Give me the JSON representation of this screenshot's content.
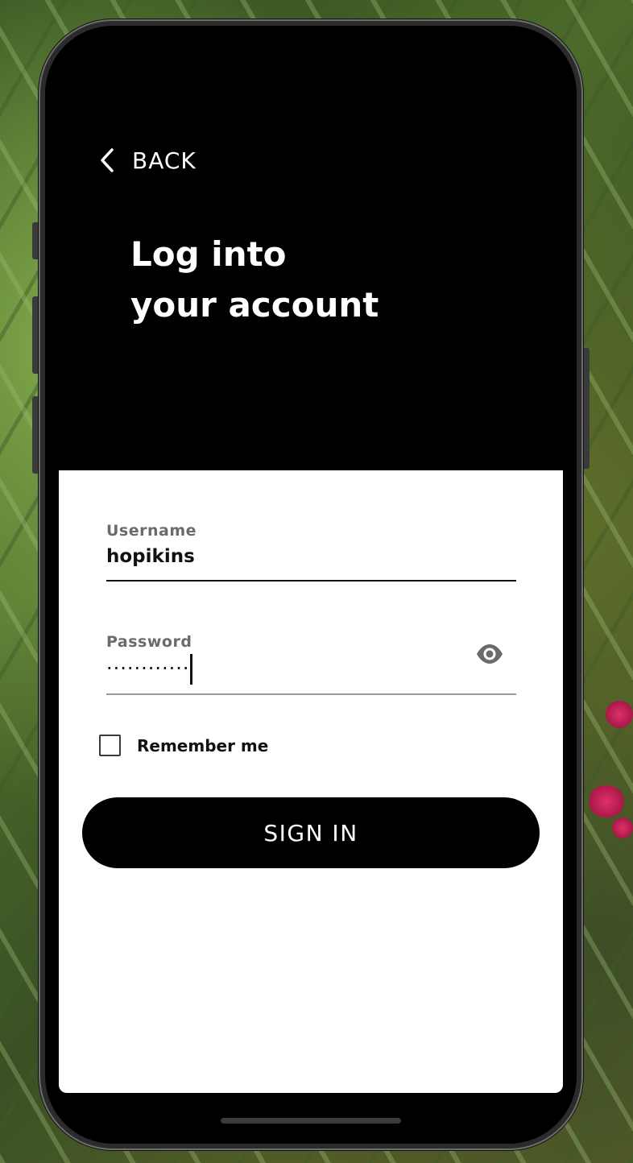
{
  "nav": {
    "back_label": "BACK"
  },
  "header": {
    "title_line1": "Log into",
    "title_line2": "your account"
  },
  "form": {
    "username": {
      "label": "Username",
      "value": "hopikins"
    },
    "password": {
      "label": "Password",
      "masked_value": "············",
      "visibility_icon": "eye-icon"
    },
    "remember_me": {
      "label": "Remember me",
      "checked": false
    },
    "submit_label": "SIGN IN"
  },
  "colors": {
    "primary": "#000000",
    "card": "#ffffff",
    "label": "#6b6b6b"
  }
}
